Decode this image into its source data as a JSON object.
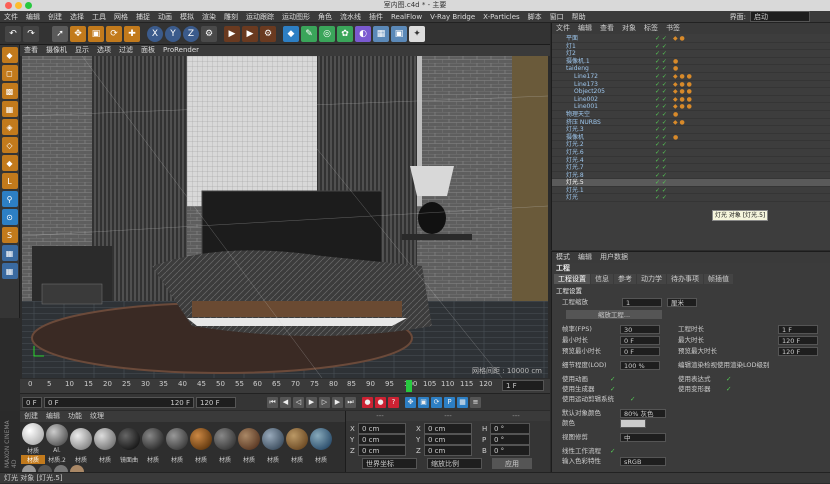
{
  "window": {
    "title": "室内图.c4d * - 主要"
  },
  "menubar": {
    "items": [
      "文件",
      "编辑",
      "创建",
      "选择",
      "工具",
      "网格",
      "捕捉",
      "动画",
      "模拟",
      "渲染",
      "雕刻",
      "运动跟踪",
      "运动图形",
      "角色",
      "流水线",
      "插件",
      "RealFlow",
      "V-Ray Bridge",
      "X-Particles",
      "脚本",
      "窗口",
      "帮助"
    ],
    "layout_label": "界面:",
    "layout_value": "启动"
  },
  "toolbar": {
    "axis_x": "X",
    "axis_y": "Y",
    "axis_z": "Z"
  },
  "viewport": {
    "menu": [
      "查看",
      "摄像机",
      "显示",
      "选项",
      "过滤",
      "面板",
      "ProRender"
    ],
    "grid_info": "网格间距 : 10000 cm"
  },
  "timeline": {
    "ticks": [
      "0",
      "5",
      "10",
      "15",
      "20",
      "25",
      "30",
      "35",
      "40",
      "45",
      "50",
      "55",
      "60",
      "65",
      "70",
      "75",
      "80",
      "85",
      "90",
      "95",
      "100",
      "105",
      "110",
      "115",
      "120"
    ],
    "current_frame": "1 F"
  },
  "transport": {
    "start": "0 F",
    "current": "0 F",
    "end": "120 F",
    "max": "120 F"
  },
  "materials": {
    "menu": [
      "创建",
      "编辑",
      "功能",
      "纹理"
    ],
    "row1": [
      "材质",
      "Al.",
      "",
      "",
      "",
      "",
      "",
      "",
      "",
      "",
      "",
      "",
      ""
    ],
    "row2": [
      "材质",
      "材质.2",
      "材质",
      "材质",
      "镜面曲",
      "材质",
      "材质",
      "材质",
      "材质",
      "材质",
      "材质",
      "材质",
      "材质"
    ],
    "brand": "MAXON CINEMA 4D"
  },
  "coordinates": {
    "header": [
      "---",
      "---",
      "---"
    ],
    "rows": [
      {
        "a": "X",
        "av": "0 cm",
        "b": "X",
        "bv": "0 cm",
        "c": "H",
        "cv": "0 °"
      },
      {
        "a": "Y",
        "av": "0 cm",
        "b": "Y",
        "bv": "0 cm",
        "c": "P",
        "cv": "0 °"
      },
      {
        "a": "Z",
        "av": "0 cm",
        "b": "Z",
        "bv": "0 cm",
        "c": "B",
        "cv": "0 °"
      }
    ],
    "world": "世界坐标",
    "scale": "缩放比例",
    "apply": "应用"
  },
  "statusbar": {
    "text": "灯光 对象 [灯光.5]"
  },
  "object_manager": {
    "menu": [
      "文件",
      "编辑",
      "查看",
      "对象",
      "标签",
      "书签"
    ],
    "items": [
      "平面",
      "灯1",
      "灯2",
      "摄像机.1",
      "taideng",
      "Line172",
      "Line173",
      "Object205",
      "Line002",
      "Line001",
      "物理天空",
      "挤压 NURBS",
      "灯光.3",
      "摄像机",
      "灯光.2",
      "灯光.6",
      "灯光.4",
      "灯光.7",
      "灯光.8",
      "灯光.5",
      "灯光.1",
      "灯光"
    ],
    "tooltip": "灯光 对象 [灯光.5]"
  },
  "attributes": {
    "menu": [
      "模式",
      "编辑",
      "用户数据"
    ],
    "title": "工程",
    "tabs": [
      "工程设置",
      "信息",
      "参考",
      "动力学",
      "待办事项",
      "帧插值"
    ],
    "section": "工程设置",
    "scale_label": "工程缩放",
    "scale_value": "1",
    "scale_unit": "厘米",
    "scale_btn": "缩放工程...",
    "fps_label": "帧率(FPS)",
    "fps": "30",
    "proj_time_label": "工程时长",
    "proj_time": "1 F",
    "min_time_label": "最小时长",
    "min_time": "0 F",
    "max_time_label": "最大时长",
    "max_time": "120 F",
    "prev_min_label": "预览最小时长",
    "prev_min": "0 F",
    "prev_max_label": "预览最大时长",
    "prev_max": "120 F",
    "lod_label": "细节程度(LOD)",
    "lod": "100 %",
    "lod_check": "编辑渲染检视使用渲染LOD级别",
    "anim_label": "使用动画",
    "expr_label": "使用表达式",
    "gen_label": "使用生成器",
    "deform_label": "使用变形器",
    "motion_label": "使用运动剪辑系统",
    "default_color_label": "默认对象颜色",
    "default_color_value": "80% 灰色",
    "color_label": "颜色",
    "view_clip_label": "视图修剪",
    "view_clip_value": "中",
    "linear_label": "线性工作流程",
    "input_color_label": "输入色彩特性",
    "input_color_value": "sRGB"
  }
}
